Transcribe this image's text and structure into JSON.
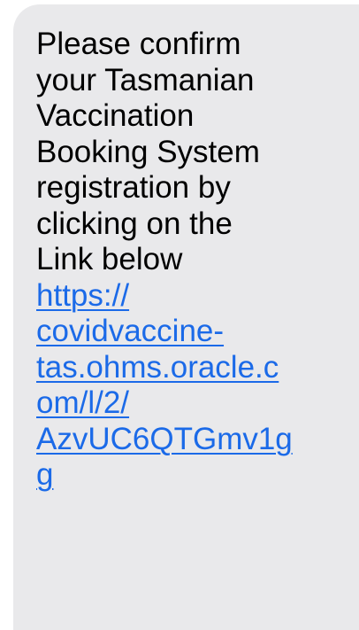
{
  "message": {
    "lines": [
      "Please confirm",
      "your Tasmanian",
      "Vaccination",
      "Booking System",
      "registration by",
      "clicking on the",
      "Link below"
    ],
    "link_lines": [
      "https://",
      "covidvaccine-",
      "tas.ohms.oracle.c",
      "om/l/2/",
      "AzvUC6QTGmv1g",
      "g"
    ]
  },
  "colors": {
    "bubble": "#e9e9eb",
    "text": "#000000",
    "link": "#1b6ae8"
  }
}
